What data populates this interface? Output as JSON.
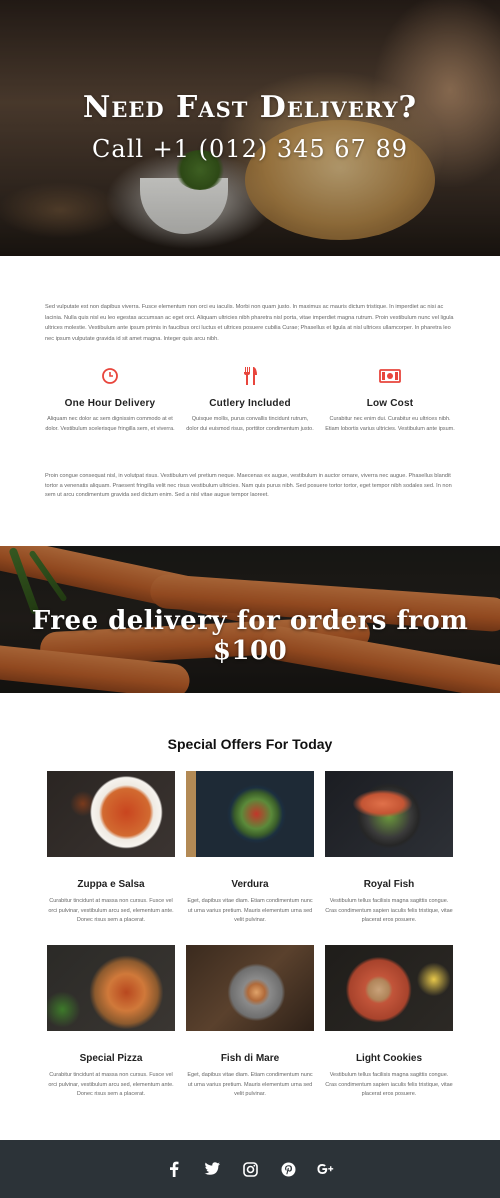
{
  "hero": {
    "title": "Need Fast Delivery?",
    "subtitle": "Call +1 (012) 345 67 89"
  },
  "intro": {
    "text": "Sed vulputate est non dapibus viverra. Fusce elementum non orci eu iaculis. Morbi non quam justo. In maximus ac mauris dictum tristique. In imperdiet ac nisi ac lacinia. Nulla quis nisl eu leo egestas accumsan ac eget orci. Aliquam ultricies nibh pharetra nisl porta, vitae imperdiet magna rutrum. Proin vestibulum nunc vel ligula ultrices molestie. Vestibulum ante ipsum primis in faucibus orci luctus et ultrices posuere cubilia Curae; Phasellus et ligula at nisl ultrices ullamcorper. In pharetra leo nec ipsum vulputate gravida id sit amet magna. Integer quis arcu nibh."
  },
  "features": [
    {
      "icon": "clock-icon",
      "title": "One Hour Delivery",
      "desc": "Aliquam nec dolor ac sem dignissim commodo at et dolor. Vestibulum scelerisque fringilla sem, et viverra."
    },
    {
      "icon": "cutlery-icon",
      "title": "Cutlery Included",
      "desc": "Quisque mollis, purus convallis tincidunt rutrum, dolor dui euismod risus, porttitor condimentum justo."
    },
    {
      "icon": "money-icon",
      "title": "Low Cost",
      "desc": "Curabitur nec enim dui. Curabitur eu ultrices nibh. Etiam lobortis varius ultricies. Vestibulum ante ipsum."
    }
  ],
  "outro": {
    "text": "Proin congue consequat nisl, in volutpat risus. Vestibulum vel pretium neque. Maecenas ex augue, vestibulum in auctor ornare, viverra nec augue. Phasellus blandit tortor a venenatis aliquam. Praesent fringilla velit nec risus vestibulum ultricies. Nam quis purus nibh. Sed posuere tortor tortor, eget tempor nibh sodales sed. In non sem ut arcu condimentum gravida sed dictum enim. Sed a nisl vitae augue tempor laoreet."
  },
  "banner": {
    "title": "Free delivery for orders from $100"
  },
  "offers": {
    "title": "Special Offers For Today",
    "items": [
      {
        "name": "Zuppa e Salsa",
        "desc": "Curabitur tincidunt at massa non cursus. Fusce vel orci pulvinar, vestibulum arcu sed, elementum ante. Donec risus sem a placerat."
      },
      {
        "name": "Verdura",
        "desc": "Eget, dapibus vitae diam. Etiam condimentum nunc ut urna varius pretium. Mauris elementum urna sed velit pulvinar."
      },
      {
        "name": "Royal Fish",
        "desc": "Vestibulum tellus facilisis magna sagittis congue. Cras condimentum sapien iaculis felis tristique, vitae placerat eros posuere."
      },
      {
        "name": "Special Pizza",
        "desc": "Curabitur tincidunt at massa non cursus. Fusce vel orci pulvinar, vestibulum arcu sed, elementum ante. Donec risus sem a placerat."
      },
      {
        "name": "Fish di Mare",
        "desc": "Eget, dapibus vitae diam. Etiam condimentum nunc ut urna varius pretium. Mauris elementum urna sed velit pulvinar."
      },
      {
        "name": "Light Cookies",
        "desc": "Vestibulum tellus facilisis magna sagittis congue. Cras condimentum sapien iaculis felis tristique, vitae placerat eros posuere."
      }
    ]
  },
  "footer": {
    "social": [
      "facebook-icon",
      "twitter-icon",
      "instagram-icon",
      "pinterest-icon",
      "google-plus-icon"
    ]
  },
  "colors": {
    "accent": "#e8453c",
    "footer_bg": "#2c3338",
    "heading": "#222222"
  }
}
